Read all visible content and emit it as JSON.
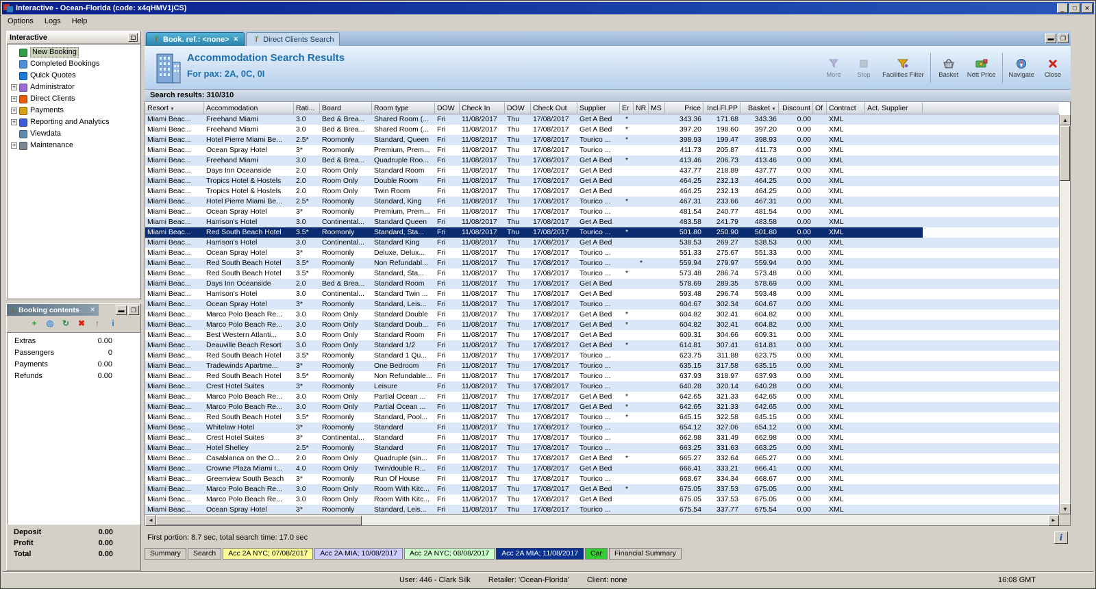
{
  "window": {
    "title": "Interactive - Ocean-Florida (code: x4qHMV1jCS)",
    "controls": {
      "minimize": "_",
      "maximize": "□",
      "close": "✕"
    }
  },
  "menu": {
    "items": [
      "Options",
      "Logs",
      "Help"
    ]
  },
  "sidebar": {
    "title": "Interactive",
    "items": [
      {
        "label": "New Booking",
        "selected": true,
        "expandable": false,
        "icon_color": "#2f9e44"
      },
      {
        "label": "Completed Bookings",
        "selected": false,
        "expandable": false,
        "icon_color": "#4a90d9"
      },
      {
        "label": "Quick Quotes",
        "selected": false,
        "expandable": false,
        "icon_color": "#1c7ed6"
      },
      {
        "label": "Administrator",
        "selected": false,
        "expandable": true,
        "icon_color": "#9c6bd0"
      },
      {
        "label": "Direct Clients",
        "selected": false,
        "expandable": true,
        "icon_color": "#e8590c"
      },
      {
        "label": "Payments",
        "selected": false,
        "expandable": true,
        "icon_color": "#d4a017"
      },
      {
        "label": "Reporting and Analytics",
        "selected": false,
        "expandable": true,
        "icon_color": "#3b5bdb"
      },
      {
        "label": "Viewdata",
        "selected": false,
        "expandable": false,
        "icon_color": "#5f8ab0"
      },
      {
        "label": "Maintenance",
        "selected": false,
        "expandable": true,
        "icon_color": "#7a8691"
      }
    ]
  },
  "booking_contents": {
    "title": "Booking contents",
    "close_glyph": "✕",
    "toolbar": [
      {
        "name": "add-icon",
        "glyph": "+",
        "color": "#1e9e36"
      },
      {
        "name": "globe-icon",
        "glyph": "◎",
        "color": "#1c7ed6"
      },
      {
        "name": "refresh-icon",
        "glyph": "↻",
        "color": "#2b8a3e"
      },
      {
        "name": "delete-icon",
        "glyph": "✖",
        "color": "#d9230f"
      },
      {
        "name": "move-up-icon",
        "glyph": "↑",
        "color": "#2b8a3e"
      },
      {
        "name": "info-icon",
        "glyph": "i",
        "color": "#1c7ed6"
      }
    ],
    "rows": [
      {
        "label": "Extras",
        "value": "0.00"
      },
      {
        "label": "Passengers",
        "value": "0"
      },
      {
        "label": "Payments",
        "value": "0.00"
      },
      {
        "label": "Refunds",
        "value": "0.00"
      }
    ],
    "totals": [
      {
        "label": "Deposit",
        "value": "0.00"
      },
      {
        "label": "Profit",
        "value": "0.00"
      },
      {
        "label": "Total",
        "value": "0.00"
      }
    ]
  },
  "tabs": [
    {
      "label": "Book. ref.: <none>",
      "active": true,
      "closable": true
    },
    {
      "label": "Direct Clients Search",
      "active": false,
      "closable": false
    }
  ],
  "header": {
    "title": "Accommodation Search Results",
    "subtitle": "For pax: 2A, 0C, 0I",
    "toolbar": [
      {
        "label": "More",
        "disabled": true
      },
      {
        "label": "Stop",
        "disabled": true
      },
      {
        "label": "Facilities Filter",
        "disabled": false
      },
      {
        "label": "Basket",
        "disabled": false
      },
      {
        "label": "Nett Price",
        "disabled": false
      },
      {
        "label": "Navigate",
        "disabled": false
      },
      {
        "label": "Close",
        "disabled": false
      }
    ]
  },
  "results": {
    "summary": "Search results: 310/310",
    "status": "First portion: 8.7 sec, total search time: 17.0 sec",
    "columns": [
      "Resort",
      "Accommodation",
      "Rati...",
      "Board",
      "Room type",
      "DOW",
      "Check In",
      "DOW",
      "Check Out",
      "Supplier",
      "Er",
      "NR",
      "MS",
      "Price",
      "Incl.Fl.PP",
      "Basket",
      "Discount",
      "Of",
      "Contract",
      "Act. Supplier"
    ],
    "row_constants": {
      "resort": "Miami Beac...",
      "dow_in": "Fri",
      "check_in": "11/08/2017",
      "dow_out": "Thu",
      "check_out": "17/08/2017",
      "discount": "0.00",
      "contract": "XML"
    },
    "selected_index": 11,
    "rows": [
      [
        "Freehand Miami",
        "3.0",
        "Bed & Brea...",
        "Shared Room (...",
        "Get A Bed",
        "er",
        "343.36",
        "171.68",
        "343.36"
      ],
      [
        "Freehand Miami",
        "3.0",
        "Bed & Brea...",
        "Shared Room (...",
        "Get A Bed",
        "er",
        "397.20",
        "198.60",
        "397.20"
      ],
      [
        "Hotel Pierre Miami Be...",
        "2.5*",
        "Roomonly",
        "Standard, Queen",
        "Tourico ...",
        "er",
        "398.93",
        "199.47",
        "398.93"
      ],
      [
        "Ocean Spray Hotel",
        "3*",
        "Roomonly",
        "Premium, Prem...",
        "Tourico ...",
        "",
        "411.73",
        "205.87",
        "411.73"
      ],
      [
        "Freehand Miami",
        "3.0",
        "Bed & Brea...",
        "Quadruple Roo...",
        "Get A Bed",
        "er",
        "413.46",
        "206.73",
        "413.46"
      ],
      [
        "Days Inn Oceanside",
        "2.0",
        "Room Only",
        "Standard Room",
        "Get A Bed",
        "",
        "437.77",
        "218.89",
        "437.77"
      ],
      [
        "Tropics Hotel & Hostels",
        "2.0",
        "Room Only",
        "Double Room",
        "Get A Bed",
        "",
        "464.25",
        "232.13",
        "464.25"
      ],
      [
        "Tropics Hotel & Hostels",
        "2.0",
        "Room Only",
        "Twin Room",
        "Get A Bed",
        "",
        "464.25",
        "232.13",
        "464.25"
      ],
      [
        "Hotel Pierre Miami Be...",
        "2.5*",
        "Roomonly",
        "Standard, King",
        "Tourico ...",
        "er",
        "467.31",
        "233.66",
        "467.31"
      ],
      [
        "Ocean Spray Hotel",
        "3*",
        "Roomonly",
        "Premium, Prem...",
        "Tourico ...",
        "",
        "481.54",
        "240.77",
        "481.54"
      ],
      [
        "Harrison's Hotel",
        "3.0",
        "Continental...",
        "Standard Queen",
        "Get A Bed",
        "",
        "483.58",
        "241.79",
        "483.58"
      ],
      [
        "Red South Beach Hotel",
        "3.5*",
        "Roomonly",
        "Standard, Sta...",
        "Tourico ...",
        "er",
        "501.80",
        "250.90",
        "501.80"
      ],
      [
        "Harrison's Hotel",
        "3.0",
        "Continental...",
        "Standard King",
        "Get A Bed",
        "",
        "538.53",
        "269.27",
        "538.53"
      ],
      [
        "Ocean Spray Hotel",
        "3*",
        "Roomonly",
        "Deluxe, Delux...",
        "Tourico ...",
        "",
        "551.33",
        "275.67",
        "551.33"
      ],
      [
        "Red South Beach Hotel",
        "3.5*",
        "Roomonly",
        "Non Refundabl...",
        "Tourico ...",
        "nr",
        "559.94",
        "279.97",
        "559.94"
      ],
      [
        "Red South Beach Hotel",
        "3.5*",
        "Roomonly",
        "Standard, Sta...",
        "Tourico ...",
        "er",
        "573.48",
        "286.74",
        "573.48"
      ],
      [
        "Days Inn Oceanside",
        "2.0",
        "Bed & Brea...",
        "Standard Room",
        "Get A Bed",
        "",
        "578.69",
        "289.35",
        "578.69"
      ],
      [
        "Harrison's Hotel",
        "3.0",
        "Continental...",
        "Standard Twin ...",
        "Get A Bed",
        "",
        "593.48",
        "296.74",
        "593.48"
      ],
      [
        "Ocean Spray Hotel",
        "3*",
        "Roomonly",
        "Standard, Leis...",
        "Tourico ...",
        "",
        "604.67",
        "302.34",
        "604.67"
      ],
      [
        "Marco Polo Beach Re...",
        "3.0",
        "Room Only",
        "Standard Double",
        "Get A Bed",
        "er",
        "604.82",
        "302.41",
        "604.82"
      ],
      [
        "Marco Polo Beach Re...",
        "3.0",
        "Room Only",
        "Standard Doub...",
        "Get A Bed",
        "er",
        "604.82",
        "302.41",
        "604.82"
      ],
      [
        "Best Western Atlanti...",
        "3.0",
        "Room Only",
        "Standard Room",
        "Get A Bed",
        "",
        "609.31",
        "304.66",
        "609.31"
      ],
      [
        "Deauville Beach Resort",
        "3.0",
        "Room Only",
        "Standard 1/2",
        "Get A Bed",
        "er",
        "614.81",
        "307.41",
        "614.81"
      ],
      [
        "Red South Beach Hotel",
        "3.5*",
        "Roomonly",
        "Standard 1 Qu...",
        "Tourico ...",
        "",
        "623.75",
        "311.88",
        "623.75"
      ],
      [
        "Tradewinds Apartme...",
        "3*",
        "Roomonly",
        "One Bedroom",
        "Tourico ...",
        "",
        "635.15",
        "317.58",
        "635.15"
      ],
      [
        "Red South Beach Hotel",
        "3.5*",
        "Roomonly",
        "Non Refundable...",
        "Tourico ...",
        "",
        "637.93",
        "318.97",
        "637.93"
      ],
      [
        "Crest Hotel Suites",
        "3*",
        "Roomonly",
        "Leisure",
        "Tourico ...",
        "",
        "640.28",
        "320.14",
        "640.28"
      ],
      [
        "Marco Polo Beach Re...",
        "3.0",
        "Room Only",
        "Partial Ocean ...",
        "Get A Bed",
        "er",
        "642.65",
        "321.33",
        "642.65"
      ],
      [
        "Marco Polo Beach Re...",
        "3.0",
        "Room Only",
        "Partial Ocean ...",
        "Get A Bed",
        "er",
        "642.65",
        "321.33",
        "642.65"
      ],
      [
        "Red South Beach Hotel",
        "3.5*",
        "Roomonly",
        "Standard, Pool...",
        "Tourico ...",
        "er",
        "645.15",
        "322.58",
        "645.15"
      ],
      [
        "Whitelaw Hotel",
        "3*",
        "Roomonly",
        "Standard",
        "Tourico ...",
        "",
        "654.12",
        "327.06",
        "654.12"
      ],
      [
        "Crest Hotel Suites",
        "3*",
        "Continental...",
        "Standard",
        "Tourico ...",
        "",
        "662.98",
        "331.49",
        "662.98"
      ],
      [
        "Hotel Shelley",
        "2.5*",
        "Roomonly",
        "Standard",
        "Tourico ...",
        "",
        "663.25",
        "331.63",
        "663.25"
      ],
      [
        "Casablanca on the O...",
        "2.0",
        "Room Only",
        "Quadruple (sin...",
        "Get A Bed",
        "er",
        "665.27",
        "332.64",
        "665.27"
      ],
      [
        "Crowne Plaza Miami I...",
        "4.0",
        "Room Only",
        "Twin/double R...",
        "Get A Bed",
        "",
        "666.41",
        "333.21",
        "666.41"
      ],
      [
        "Greenview South Beach",
        "3*",
        "Roomonly",
        "Run Of House",
        "Tourico ...",
        "",
        "668.67",
        "334.34",
        "668.67"
      ],
      [
        "Marco Polo Beach Re...",
        "3.0",
        "Room Only",
        "Room With Kitc...",
        "Get A Bed",
        "er",
        "675.05",
        "337.53",
        "675.05"
      ],
      [
        "Marco Polo Beach Re...",
        "3.0",
        "Room Only",
        "Room With Kitc...",
        "Get A Bed",
        "",
        "675.05",
        "337.53",
        "675.05"
      ],
      [
        "Ocean Spray Hotel",
        "3*",
        "Roomonly",
        "Standard, Leis...",
        "Tourico ...",
        "",
        "675.54",
        "337.77",
        "675.54"
      ]
    ]
  },
  "bottom_tabs": [
    {
      "label": "Summary",
      "bg": "#d4d0c8",
      "fg": "#000000",
      "active": false
    },
    {
      "label": "Search",
      "bg": "#d4d0c8",
      "fg": "#000000",
      "active": false
    },
    {
      "label": "Acc 2A NYC; 07/08/2017",
      "bg": "#ffff99",
      "fg": "#000000",
      "active": false
    },
    {
      "label": "Acc 2A MIA; 10/08/2017",
      "bg": "#ccccff",
      "fg": "#000000",
      "active": false
    },
    {
      "label": "Acc 2A NYC; 08/08/2017",
      "bg": "#ccffcc",
      "fg": "#000000",
      "active": false
    },
    {
      "label": "Acc 2A MIA; 11/08/2017",
      "bg": "#0a3190",
      "fg": "#ffffff",
      "active": true
    },
    {
      "label": "Car",
      "bg": "#33cc33",
      "fg": "#000000",
      "active": false
    },
    {
      "label": "Financial Summary",
      "bg": "#d4d0c8",
      "fg": "#000000",
      "active": false
    }
  ],
  "statusbar": {
    "user": "User: 446 - Clark Silk",
    "retailer": "Retailer: 'Ocean-Florida'",
    "client": "Client: none",
    "time": "16:08 GMT"
  }
}
